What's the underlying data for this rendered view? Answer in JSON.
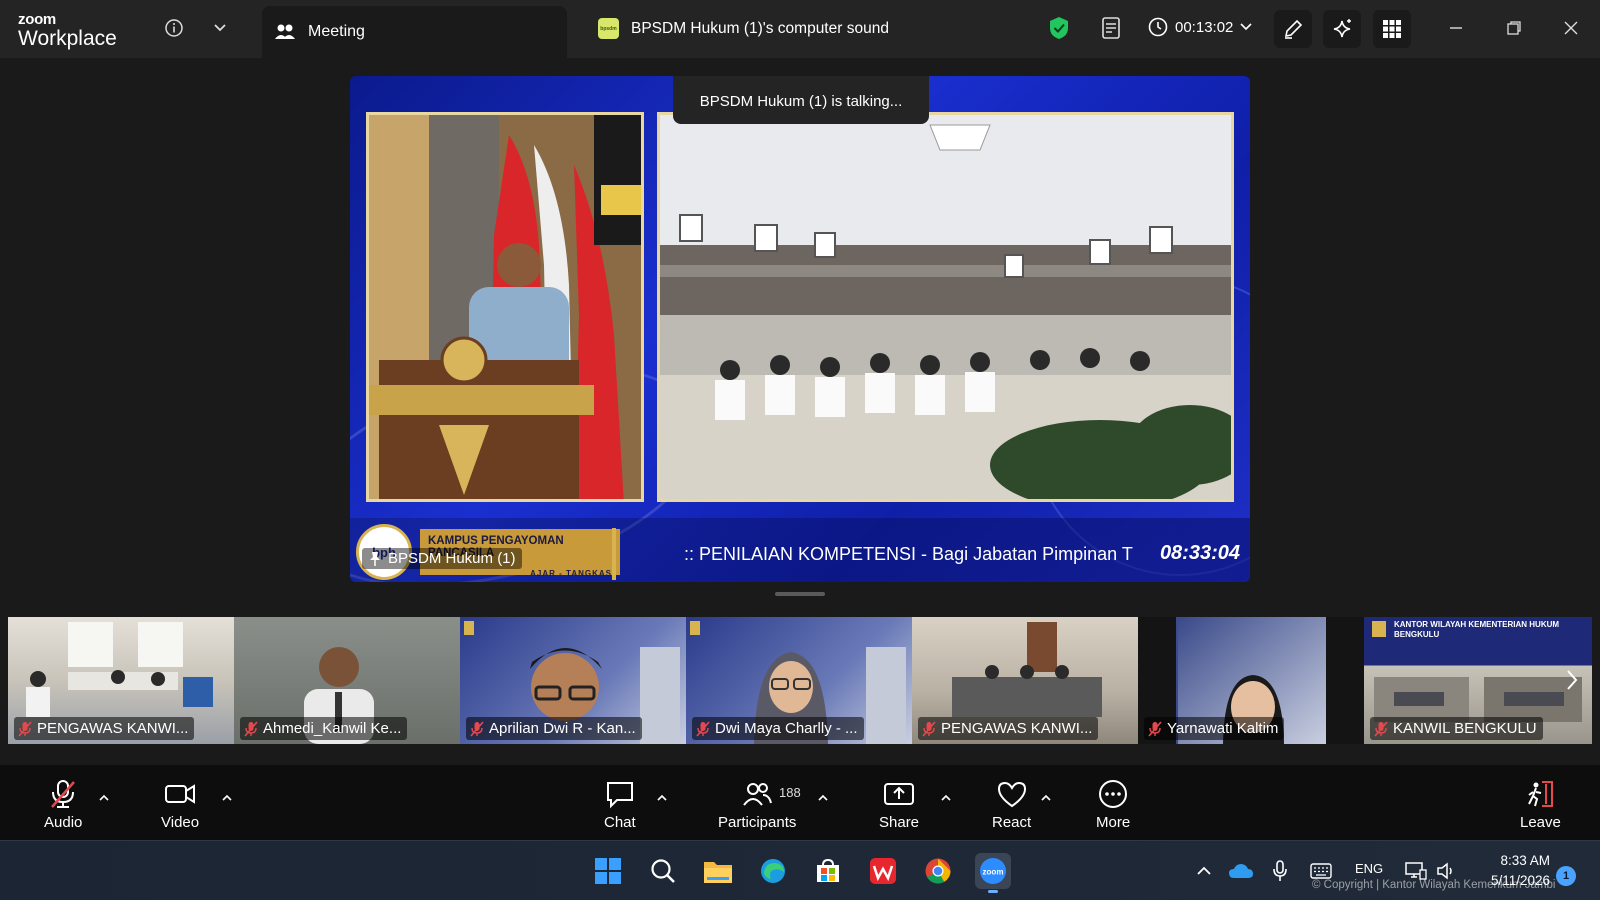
{
  "titlebar": {
    "brand_top": "zoom",
    "brand_bottom": "Workplace",
    "meeting_tab_label": "Meeting",
    "computer_sound_label": "BPSDM Hukum (1)'s computer sound",
    "timer": "00:13:02",
    "shield_color": "#22c55e"
  },
  "stage": {
    "talking_notice": "BPSDM Hukum (1) is talking...",
    "speaker_name": "BPSDM Hukum (1)",
    "campus_logo_text": "bph",
    "campus_title": "KAMPUS PENGAYOMAN PANCASILA",
    "campus_subtitle": "AJAR - TANGKAS",
    "ticker_text": ":: PENILAIAN KOMPETENSI - Bagi Jabatan Pimpinan T",
    "ticker_time": "08:33:04",
    "background_color": "#1a2fd0",
    "frame_color": "#e8d7a0"
  },
  "gallery": {
    "tiles": [
      {
        "name": "PENGAWAS KANWI...",
        "color": "#c9c4ba"
      },
      {
        "name": "Ahmedi_Kanwil Ke...",
        "color": "#7a7f7a"
      },
      {
        "name": "Aprilian Dwi R - Kan...",
        "color": "#3a4a8a"
      },
      {
        "name": "Dwi Maya Charlly - ...",
        "color": "#3f4f90"
      },
      {
        "name": "PENGAWAS KANWI...",
        "color": "#b9b0a4"
      },
      {
        "name": "Yarnawati Kaltim",
        "color": "#3a4a8a"
      },
      {
        "name": "KANWIL BENGKULU",
        "color": "#2a3a80"
      }
    ],
    "bengkulu_banner": "KANTOR WILAYAH KEMENTERIAN HUKUM BENGKULU"
  },
  "toolbar": {
    "audio": "Audio",
    "video": "Video",
    "chat": "Chat",
    "participants": "Participants",
    "participant_count": "188",
    "share": "Share",
    "react": "React",
    "more": "More",
    "leave": "Leave",
    "leave_color": "#e5484d",
    "muted_color": "#e5484d"
  },
  "taskbar": {
    "language": "ENG",
    "time": "8:33 AM",
    "date": "5/11/2026",
    "notification_count": "1",
    "zoom_app_label": "zoom",
    "copyright": "© Copyright | Kantor Wilayah Kemenkum Jambi",
    "icons": [
      "windows-start-icon",
      "search-icon",
      "file-explorer-icon",
      "edge-icon",
      "ms-store-icon",
      "wps-office-icon",
      "chrome-icon",
      "zoom-icon"
    ]
  }
}
